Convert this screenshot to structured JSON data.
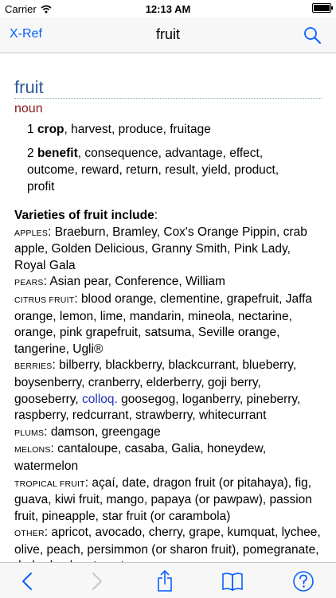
{
  "status": {
    "carrier": "Carrier",
    "time": "12:13 AM"
  },
  "nav": {
    "back_label": "X-Ref",
    "title": "fruit"
  },
  "entry": {
    "headword": "fruit",
    "pos": "noun",
    "senses": [
      {
        "num": "1",
        "key": "crop",
        "rest": ", harvest, produce, fruitage"
      },
      {
        "num": "2",
        "key": "benefit",
        "rest": ", consequence, advantage, effect, outcome, reward, return, result, yield, product, profit"
      }
    ],
    "varieties_heading": "Varieties of fruit include",
    "varieties": {
      "apples": {
        "label": "APPLES",
        "text": "Braeburn, Bramley, Cox's Orange Pippin, crab apple, Golden Delicious, Granny Smith, Pink Lady, Royal Gala"
      },
      "pears": {
        "label": "PEARS",
        "text": "Asian pear, Conference, William"
      },
      "citrus": {
        "label": "CITRUS FRUIT",
        "text": "blood orange, clementine, grapefruit, Jaffa orange, lemon, lime, mandarin, mineola, nectarine, orange, pink grapefruit, satsuma, Seville orange, tangerine, Ugli®"
      },
      "berries": {
        "label": "BERRIES",
        "text1": "bilberry, blackberry, blackcurrant, blueberry, boysenberry, cranberry, elderberry, goji berry, gooseberry,",
        "colloq": "colloq.",
        "text2": "goosegog, loganberry, pineberry, raspberry, redcurrant, strawberry, whitecurrant"
      },
      "plums": {
        "label": "PLUMS",
        "text": "damson, greengage"
      },
      "melons": {
        "label": "MELONS",
        "text": "cantaloupe, casaba, Galia, honeydew, watermelon"
      },
      "tropical": {
        "label": "TROPICAL FRUIT",
        "text": "açaí, date, dragon fruit (or pitahaya), fig, guava, kiwi fruit, mango, papaya (or pawpaw), passion fruit, pineapple, star fruit (or carambola)"
      },
      "other": {
        "label": "OTHER",
        "text": "apricot, avocado, cherry, grape, kumquat, lychee, olive, peach, persimmon (or sharon fruit), pomegranate, rhubarb, sloe, tomato"
      }
    }
  },
  "colors": {
    "accent": "#0a60fe",
    "headword": "#2d5a9a",
    "pos": "#8a1b1b",
    "colloq": "#2233bb"
  },
  "toolbar": {
    "icons": [
      "back-chevron-icon",
      "forward-chevron-icon",
      "share-icon",
      "book-icon",
      "help-icon"
    ]
  }
}
